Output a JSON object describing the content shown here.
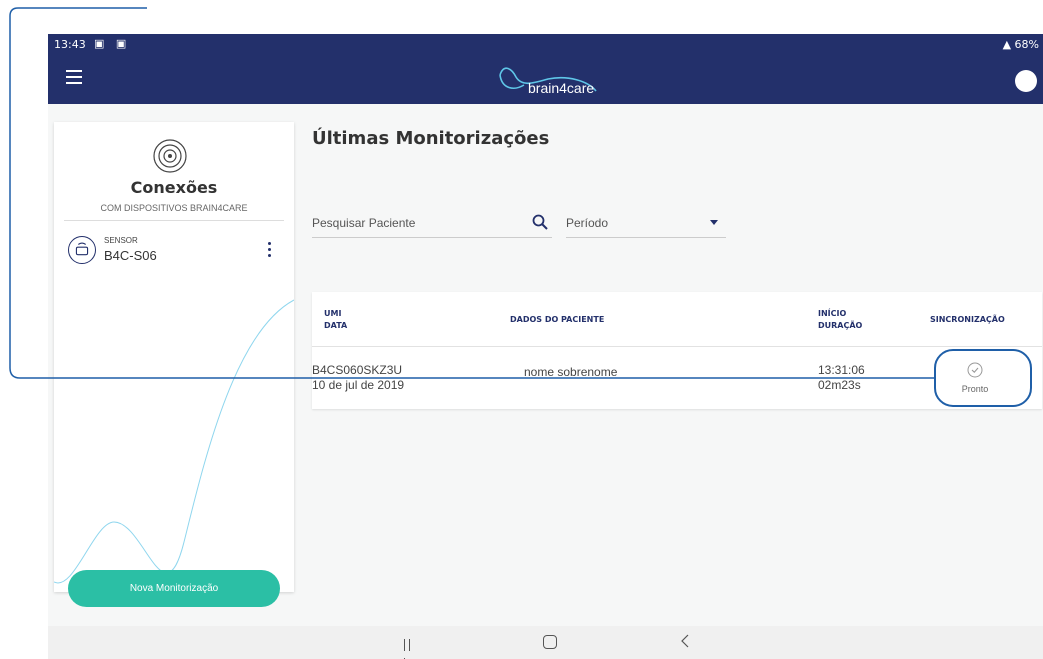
{
  "status_bar": {
    "time": "13:43",
    "notification_icons": [
      "image-icon",
      "person-icon"
    ],
    "right_text": "68%"
  },
  "app_bar": {
    "logo_text": "brain4care",
    "menu_icon": "hamburger-menu-icon",
    "avatar_icon": "avatar-icon"
  },
  "sidebar": {
    "title": "Conexões",
    "subtitle": "COM DISPOSITIVOS BRAIN4CARE",
    "sensor": {
      "label": "SENSOR",
      "name": "B4C-S06"
    },
    "new_button_label": "Nova Monitorização"
  },
  "main": {
    "title": "Últimas Monitorizações",
    "search": {
      "placeholder": "Pesquisar Paciente"
    },
    "period": {
      "value": "Período"
    },
    "table": {
      "headers": {
        "umi": "UMI",
        "data": "DATA",
        "paciente": "DADOS DO PACIENTE",
        "inicio": "INÍCIO",
        "duracao": "DURAÇÃO",
        "sync": "SINCRONIZAÇÃO"
      },
      "rows": [
        {
          "umi": "B4CS060SKZ3U",
          "date": "10 de jul de 2019",
          "patient": "nome sobrenome",
          "start": "13:31:06",
          "duration": "02m23s",
          "sync_status": "Pronto"
        }
      ]
    }
  },
  "colors": {
    "primary": "#23306b",
    "accent": "#2bbfa5",
    "highlight": "#1f5fa8"
  }
}
